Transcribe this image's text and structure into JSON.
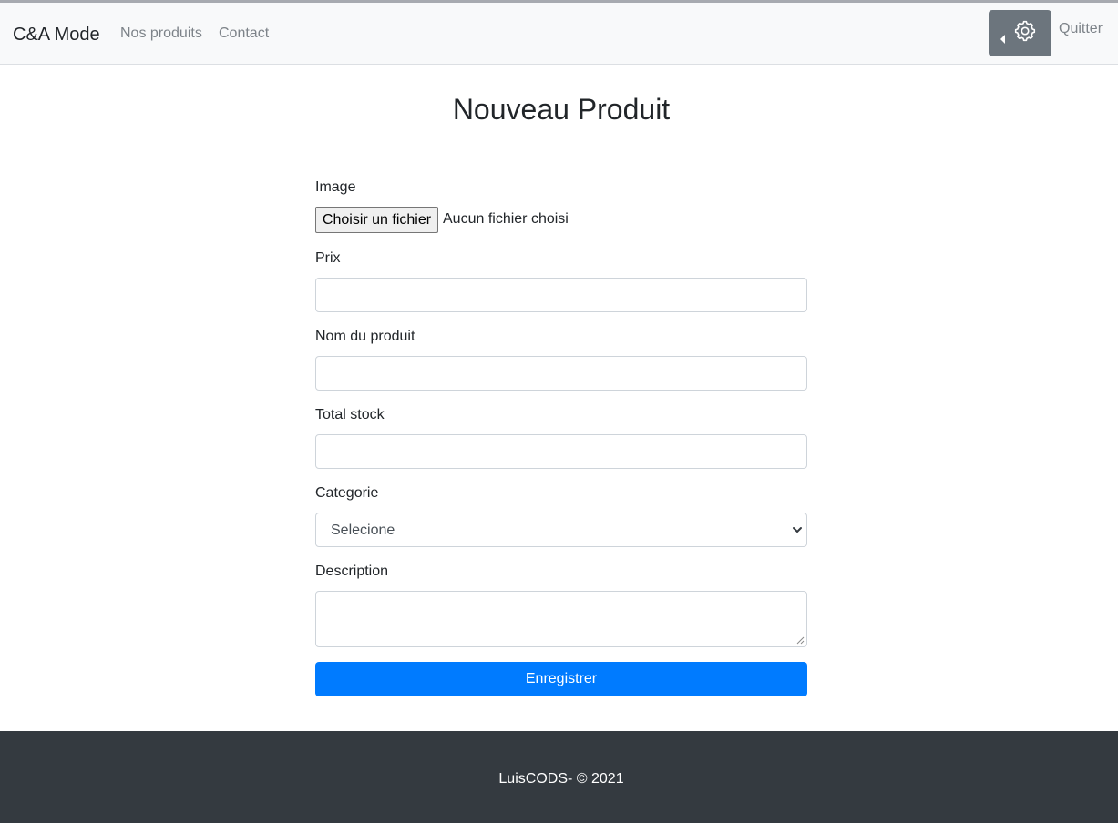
{
  "navbar": {
    "brand": "C&A Mode",
    "links": [
      "Nos produits",
      "Contact"
    ],
    "settings_icon": "gear-icon",
    "quit_label": "Quitter"
  },
  "page": {
    "title": "Nouveau Produit"
  },
  "form": {
    "image": {
      "label": "Image",
      "button_label": "Choisir un fichier",
      "status": "Aucun fichier choisi"
    },
    "price": {
      "label": "Prix",
      "value": ""
    },
    "name": {
      "label": "Nom du produit",
      "value": ""
    },
    "stock": {
      "label": "Total stock",
      "value": ""
    },
    "category": {
      "label": "Categorie",
      "selected": "Selecione"
    },
    "description": {
      "label": "Description",
      "value": ""
    },
    "submit_label": "Enregistrer"
  },
  "footer": {
    "text": "LuisCODS- © 2021"
  },
  "colors": {
    "primary": "#007bff",
    "navbar_bg": "#f8f9fa",
    "settings_button_bg": "#6c757d",
    "footer_bg": "#343a40"
  }
}
